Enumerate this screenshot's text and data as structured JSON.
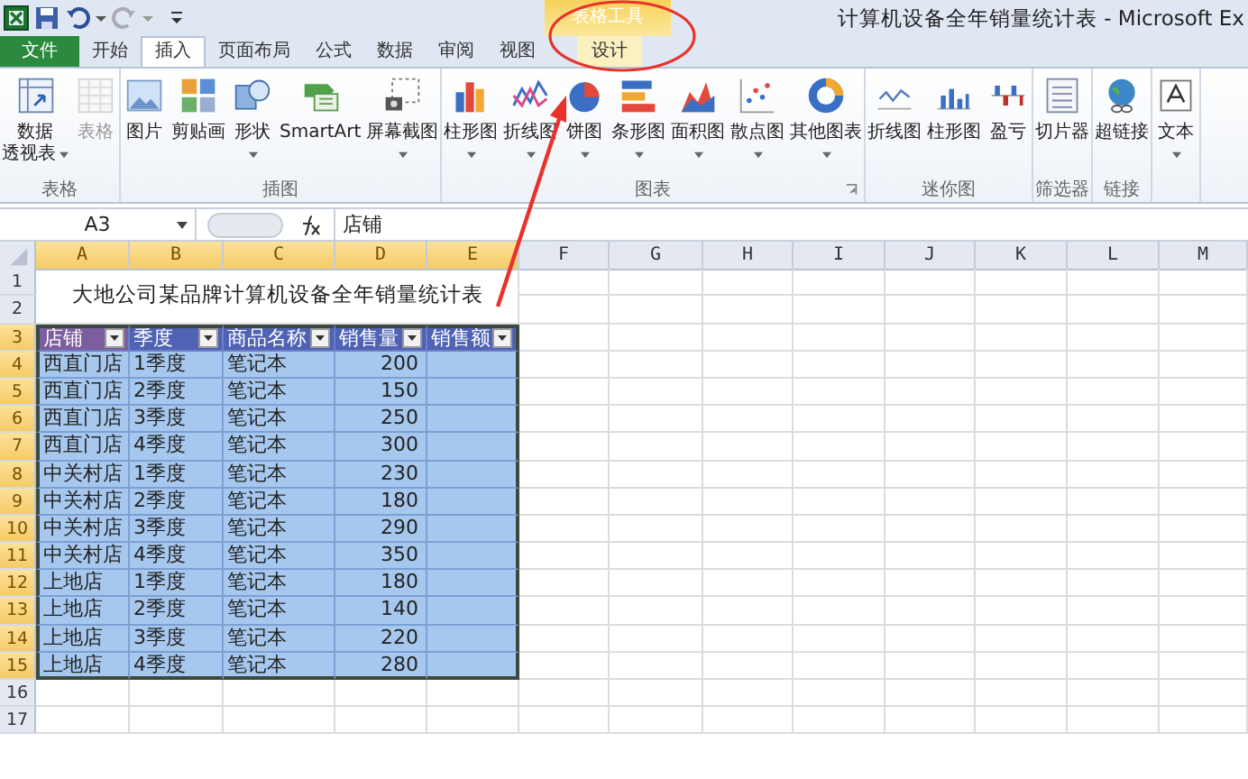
{
  "window": {
    "title": "计算机设备全年销量统计表 - Microsoft Ex"
  },
  "contextual_tab_group": {
    "label": "表格工具"
  },
  "tabs": [
    {
      "label": "文件",
      "kind": "file",
      "selected": false
    },
    {
      "label": "开始",
      "kind": "normal",
      "selected": false
    },
    {
      "label": "插入",
      "kind": "normal",
      "selected": true
    },
    {
      "label": "页面布局",
      "kind": "normal",
      "selected": false
    },
    {
      "label": "公式",
      "kind": "normal",
      "selected": false
    },
    {
      "label": "数据",
      "kind": "normal",
      "selected": false
    },
    {
      "label": "审阅",
      "kind": "normal",
      "selected": false
    },
    {
      "label": "视图",
      "kind": "normal",
      "selected": false
    },
    {
      "label": "设计",
      "kind": "contextual",
      "selected": false
    }
  ],
  "ribbon_groups": [
    {
      "label": "表格",
      "buttons": [
        {
          "label_lines": [
            "数据",
            "透视表"
          ],
          "dropdown": true,
          "disabled": false
        },
        {
          "label": "表格",
          "dropdown": false,
          "disabled": true
        }
      ]
    },
    {
      "label": "插图",
      "buttons": [
        {
          "label": "图片",
          "dropdown": false,
          "disabled": false
        },
        {
          "label": "剪贴画",
          "dropdown": false,
          "disabled": false
        },
        {
          "label": "形状",
          "dropdown": true,
          "disabled": false
        },
        {
          "label": "SmartArt",
          "dropdown": false,
          "disabled": false
        },
        {
          "label": "屏幕截图",
          "dropdown": true,
          "disabled": false
        }
      ]
    },
    {
      "label": "图表",
      "launcher": true,
      "buttons": [
        {
          "label": "柱形图",
          "dropdown": true,
          "disabled": false
        },
        {
          "label": "折线图",
          "dropdown": true,
          "disabled": false
        },
        {
          "label": "饼图",
          "dropdown": true,
          "disabled": false
        },
        {
          "label": "条形图",
          "dropdown": true,
          "disabled": false
        },
        {
          "label": "面积图",
          "dropdown": true,
          "disabled": false
        },
        {
          "label": "散点图",
          "dropdown": true,
          "disabled": false
        },
        {
          "label": "其他图表",
          "dropdown": true,
          "disabled": false
        }
      ]
    },
    {
      "label": "迷你图",
      "buttons": [
        {
          "label": "折线图",
          "dropdown": false,
          "disabled": false
        },
        {
          "label": "柱形图",
          "dropdown": false,
          "disabled": false
        },
        {
          "label": "盈亏",
          "dropdown": false,
          "disabled": false
        }
      ]
    },
    {
      "label": "筛选器",
      "buttons": [
        {
          "label": "切片器",
          "dropdown": false,
          "disabled": false
        }
      ]
    },
    {
      "label": "链接",
      "buttons": [
        {
          "label": "超链接",
          "dropdown": false,
          "disabled": false
        }
      ]
    },
    {
      "buttons": [
        {
          "label": "文本",
          "dropdown": true,
          "disabled": false
        }
      ]
    }
  ],
  "formula_bar": {
    "name_box": "A3",
    "value": "店铺"
  },
  "sheet": {
    "columns": [
      {
        "label": "A",
        "selected": true
      },
      {
        "label": "B",
        "selected": true
      },
      {
        "label": "C",
        "selected": true
      },
      {
        "label": "D",
        "selected": true
      },
      {
        "label": "E",
        "selected": true
      },
      {
        "label": "F",
        "selected": false
      },
      {
        "label": "G",
        "selected": false
      },
      {
        "label": "H",
        "selected": false
      },
      {
        "label": "I",
        "selected": false
      },
      {
        "label": "J",
        "selected": false
      },
      {
        "label": "K",
        "selected": false
      },
      {
        "label": "L",
        "selected": false
      },
      {
        "label": "M",
        "selected": false
      }
    ],
    "rows": [
      {
        "label": "1",
        "selected": false
      },
      {
        "label": "2",
        "selected": false
      },
      {
        "label": "3",
        "selected": true
      },
      {
        "label": "4",
        "selected": true
      },
      {
        "label": "5",
        "selected": true
      },
      {
        "label": "6",
        "selected": true
      },
      {
        "label": "7",
        "selected": true
      },
      {
        "label": "8",
        "selected": true
      },
      {
        "label": "9",
        "selected": true
      },
      {
        "label": "10",
        "selected": true
      },
      {
        "label": "11",
        "selected": true
      },
      {
        "label": "12",
        "selected": true
      },
      {
        "label": "13",
        "selected": true
      },
      {
        "label": "14",
        "selected": true
      },
      {
        "label": "15",
        "selected": true
      },
      {
        "label": "16",
        "selected": false
      },
      {
        "label": "17",
        "selected": false
      }
    ],
    "title": "大地公司某品牌计算机设备全年销量统计表"
  },
  "table": {
    "headers": [
      {
        "text": "店铺",
        "selected": true
      },
      {
        "text": "季度",
        "selected": false
      },
      {
        "text": "商品名称",
        "selected": false
      },
      {
        "text": "销售量",
        "selected": false
      },
      {
        "text": "销售额",
        "selected": false
      }
    ],
    "rows": [
      [
        "西直门店",
        "1季度",
        "笔记本",
        "200"
      ],
      [
        "西直门店",
        "2季度",
        "笔记本",
        "150"
      ],
      [
        "西直门店",
        "3季度",
        "笔记本",
        "250"
      ],
      [
        "西直门店",
        "4季度",
        "笔记本",
        "300"
      ],
      [
        "中关村店",
        "1季度",
        "笔记本",
        "230"
      ],
      [
        "中关村店",
        "2季度",
        "笔记本",
        "180"
      ],
      [
        "中关村店",
        "3季度",
        "笔记本",
        "290"
      ],
      [
        "中关村店",
        "4季度",
        "笔记本",
        "350"
      ],
      [
        "上地店",
        "1季度",
        "笔记本",
        "180"
      ],
      [
        "上地店",
        "2季度",
        "笔记本",
        "140"
      ],
      [
        "上地店",
        "3季度",
        "笔记本",
        "220"
      ],
      [
        "上地店",
        "4季度",
        "笔记本",
        "280"
      ]
    ]
  }
}
